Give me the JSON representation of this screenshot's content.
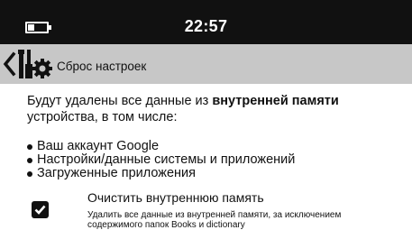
{
  "status_bar": {
    "time": "22:57",
    "battery_icon": "battery-low-icon"
  },
  "header": {
    "back_icon": "chevron-left-icon",
    "settings_icon": "tools-gear-icon",
    "title": "Сброс настроек"
  },
  "main": {
    "intro_prefix": "Будут удалены все данные из ",
    "intro_bold": "внутренней памяти",
    "intro_suffix": " устройства, в том числе:",
    "items": [
      "Ваш аккаунт Google",
      "Настройки/данные системы и приложений",
      "Загруженные приложения"
    ],
    "option": {
      "checked": true,
      "title": "Очистить внутреннюю память",
      "description": "Удалить все данные из внутренней памяти, за исключением содержимого папок Books и dictionary"
    }
  },
  "colors": {
    "status_bar_bg": "#111111",
    "header_bg": "#c7c7c7",
    "text": "#111111"
  }
}
